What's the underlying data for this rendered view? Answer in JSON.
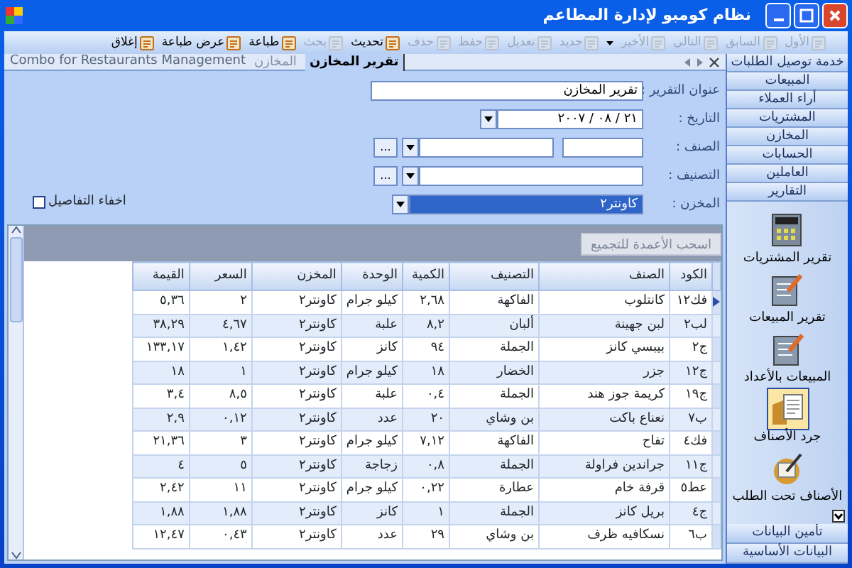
{
  "window": {
    "title": "نظام كومبو لإدارة المطاعم"
  },
  "toolbar": {
    "navigation": [
      {
        "label": "الأول",
        "disabled": true
      },
      {
        "label": "السابق",
        "disabled": true
      },
      {
        "label": "التالي",
        "disabled": true
      },
      {
        "label": "الأخير",
        "disabled": true
      }
    ],
    "actions": [
      {
        "label": "جديد",
        "disabled": true
      },
      {
        "label": "تعديل",
        "disabled": true
      },
      {
        "label": "حفظ",
        "disabled": true
      },
      {
        "label": "حذف",
        "disabled": true
      },
      {
        "label": "تحديث",
        "disabled": false
      },
      {
        "label": "بحث",
        "disabled": true
      },
      {
        "label": "طباعة",
        "disabled": false
      },
      {
        "label": "عرض طباعة",
        "disabled": false
      },
      {
        "label": "إغلاق",
        "disabled": false
      }
    ]
  },
  "tabs": [
    {
      "label": "تقرير المخازن",
      "selected": true
    },
    {
      "label": "المخازن",
      "selected": false
    }
  ],
  "tab_strip_caption": "Combo for Restaurants Management",
  "sidebar": {
    "groups_top": [
      "خدمة توصيل الطلبات",
      "المبيعات",
      "أراء العملاء",
      "المشتريات",
      "المخازن",
      "الحسابات",
      "العاملين",
      "التقارير"
    ],
    "items": [
      {
        "label": "تقرير المشتريات",
        "selected": false
      },
      {
        "label": "تقرير المبيعات",
        "selected": false
      },
      {
        "label": "المبيعات بالأعداد",
        "selected": false
      },
      {
        "label": "جرد الأصناف",
        "selected": true
      },
      {
        "label": "الأصناف تحت الطلب",
        "selected": false
      }
    ],
    "groups_bottom": [
      "تأمين البيانات",
      "البيانات الأساسية"
    ]
  },
  "form": {
    "fields": [
      {
        "label": "عنوان التقرير :",
        "kind": "text",
        "value": "تقرير المخازن",
        "focused": false
      },
      {
        "label": "التاريخ :",
        "kind": "date",
        "value": "٢١ / ٠٨ / ٢٠٠٧",
        "focused": false
      },
      {
        "label": "الصنف :",
        "kind": "code_lookup",
        "button_label": "...",
        "focused": false
      },
      {
        "label": "التصنيف :",
        "kind": "lookup",
        "button_label": "...",
        "focused": false
      },
      {
        "label": "المخزن :",
        "kind": "select",
        "value": "كاونتر٢",
        "focused": true
      }
    ],
    "hide_details": {
      "label": "اخفاء التفاصيل",
      "checked": false
    }
  },
  "grid": {
    "group_hint": "اسحب الأعمدة للتجميع",
    "columns": [
      "الكود",
      "الصنف",
      "التصنيف",
      "الكمية",
      "الوحدة",
      "المخزن",
      "السعر",
      "القيمة"
    ],
    "rows": [
      {
        "selected": true,
        "cells": [
          "فك١٢",
          "كانتلوب",
          "الفاكهة",
          "٢,٦٨",
          "كيلو جرام",
          "كاونتر٢",
          "٢",
          "٥,٣٦"
        ]
      },
      {
        "selected": false,
        "cells": [
          "لب٢",
          "لبن جهينة",
          "ألبان",
          "٨,٢",
          "علبة",
          "كاونتر٢",
          "٤,٦٧",
          "٣٨,٢٩"
        ]
      },
      {
        "selected": false,
        "cells": [
          "ج٢",
          "بيبسي كانز",
          "الجملة",
          "٩٤",
          "كانز",
          "كاونتر٢",
          "١,٤٢",
          "١٣٣,١٧"
        ]
      },
      {
        "selected": false,
        "cells": [
          "ج١٢",
          "جزر",
          "الخضار",
          "١٨",
          "كيلو جرام",
          "كاونتر٢",
          "١",
          "١٨"
        ]
      },
      {
        "selected": false,
        "cells": [
          "ج١٩",
          "كريمة جوز هند",
          "الجملة",
          "٠,٤",
          "علبة",
          "كاونتر٢",
          "٨,٥",
          "٣,٤"
        ]
      },
      {
        "selected": false,
        "cells": [
          "ب٧",
          "نعناع باكت",
          "بن وشاي",
          "٢٠",
          "عدد",
          "كاونتر٢",
          "٠,١٢",
          "٢,٩"
        ]
      },
      {
        "selected": false,
        "cells": [
          "فك٤",
          "تفاح",
          "الفاكهة",
          "٧,١٢",
          "كيلو جرام",
          "كاونتر٢",
          "٣",
          "٢١,٣٦"
        ]
      },
      {
        "selected": false,
        "cells": [
          "ج١١",
          "جراندين فراولة",
          "الجملة",
          "٠,٨",
          "زجاجة",
          "كاونتر٢",
          "٥",
          "٤"
        ]
      },
      {
        "selected": false,
        "cells": [
          "عط٥",
          "قرفة خام",
          "عطارة",
          "٠,٢٢",
          "كيلو جرام",
          "كاونتر٢",
          "١١",
          "٢,٤٢"
        ]
      },
      {
        "selected": false,
        "cells": [
          "ج٤",
          "بريل كانز",
          "الجملة",
          "١",
          "كانز",
          "كاونتر٢",
          "١,٨٨",
          "١,٨٨"
        ]
      },
      {
        "selected": false,
        "cells": [
          "ب٦",
          "نسكافيه ظرف",
          "بن وشاي",
          "٢٩",
          "عدد",
          "كاونتر٢",
          "٠,٤٣",
          "١٢,٤٧"
        ]
      }
    ]
  }
}
